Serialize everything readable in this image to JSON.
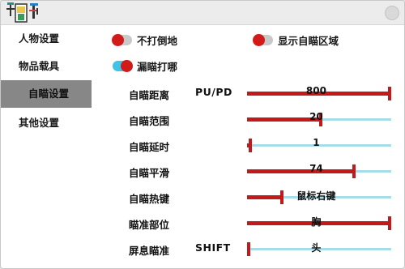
{
  "toggles": [
    {
      "label": "不打倒地",
      "on": false
    },
    {
      "label": "显示自瞄区域",
      "on": false
    },
    {
      "label": "漏瞄打哪",
      "on": true
    }
  ],
  "sidebar": {
    "items": [
      {
        "label": "人物设置"
      },
      {
        "label": "物品载具"
      },
      {
        "label": "自瞄设置",
        "active": true
      },
      {
        "label": "其他设置"
      }
    ]
  },
  "settings": [
    {
      "label": "自瞄距离",
      "key": "PU/PD",
      "value_text": "800",
      "fill": 1.0
    },
    {
      "label": "自瞄范围",
      "key": "",
      "value_text": "20",
      "fill": 0.51
    },
    {
      "label": "自瞄延时",
      "key": "",
      "value_text": "1",
      "fill": 0.02
    },
    {
      "label": "自瞄平滑",
      "key": "",
      "value_text": "74",
      "fill": 0.74
    },
    {
      "label": "自瞄热键",
      "key": "",
      "value_text": "鼠标右键",
      "fill": 0.24
    },
    {
      "label": "瞄准部位",
      "key": "",
      "value_text": "胸",
      "fill": 1.0
    },
    {
      "label": "屏息瞄准",
      "key": "SHIFT",
      "value_text": "头",
      "fill": 0.0
    }
  ],
  "colors": {
    "accent_red": "#c41919",
    "toggle_on": "#3fc3e6",
    "rail": "#a7dce8",
    "active_nav": "#878787"
  }
}
